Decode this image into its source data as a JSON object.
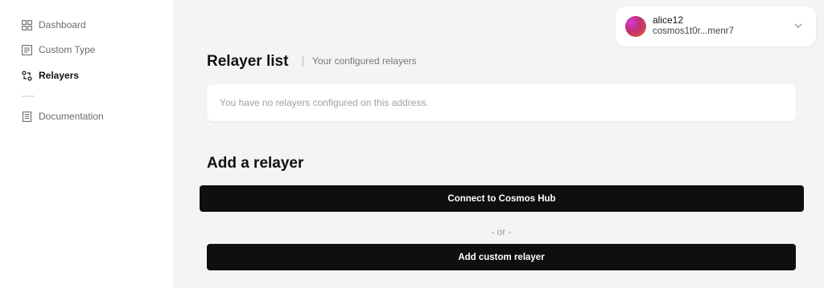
{
  "sidebar": {
    "items": [
      {
        "label": "Dashboard",
        "icon": "dashboard-grid-icon",
        "active": false
      },
      {
        "label": "Custom Type",
        "icon": "document-icon",
        "active": false
      },
      {
        "label": "Relayers",
        "icon": "relayers-icon",
        "active": true
      },
      {
        "label": "Documentation",
        "icon": "book-icon",
        "active": false
      }
    ]
  },
  "account": {
    "name": "alice12",
    "address": "cosmos1t0r...menr7",
    "chevron_icon": "chevron-down-icon"
  },
  "relayer_list": {
    "title": "Relayer list",
    "subtitle": "Your configured relayers",
    "empty_message": "You have no relayers configured on this address."
  },
  "add_relayer": {
    "title": "Add a relayer",
    "connect_label": "Connect to Cosmos Hub",
    "or_label": "- or -",
    "custom_label": "Add custom relayer"
  },
  "colors": {
    "background": "#f4f4f5",
    "surface": "#ffffff",
    "button": "#0f0f10",
    "muted_text": "#a0a0a0"
  }
}
